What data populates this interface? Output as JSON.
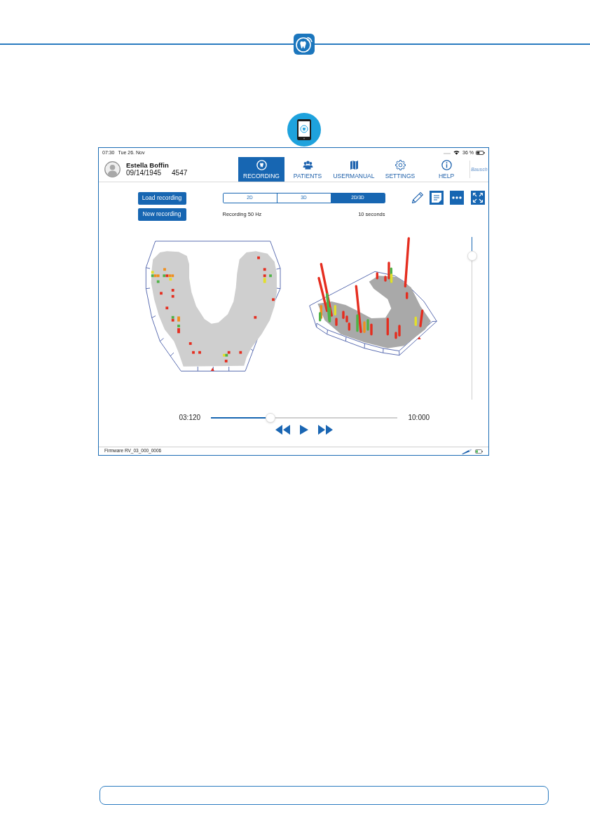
{
  "status_bar": {
    "time": "07:30",
    "date": "Tue 26. Nov",
    "battery": "36 %"
  },
  "patient": {
    "name": "Estella Boffin",
    "birth_date": "09/14/1945",
    "id": "4547"
  },
  "nav_tabs": [
    {
      "label": "RECORDING",
      "selected": true
    },
    {
      "label": "PATIENTS",
      "selected": false
    },
    {
      "label": "USERMANUAL",
      "selected": false
    },
    {
      "label": "SETTINGS",
      "selected": false
    },
    {
      "label": "HELP",
      "selected": false
    }
  ],
  "logo": "Bausch",
  "buttons": [
    "Load recording",
    "New recording"
  ],
  "view_modes": [
    {
      "label": "2D",
      "selected": false
    },
    {
      "label": "3D",
      "selected": false
    },
    {
      "label": "2D/3D",
      "selected": true
    }
  ],
  "recording_info": {
    "rate": "Recording 50 Hz",
    "duration": "10 seconds"
  },
  "side_slider": {
    "level": 0.12
  },
  "playback": {
    "elapsed": "03:120",
    "level": 0.32,
    "total": "10:000"
  },
  "firmware": "Firmware RV_03_000_0006"
}
